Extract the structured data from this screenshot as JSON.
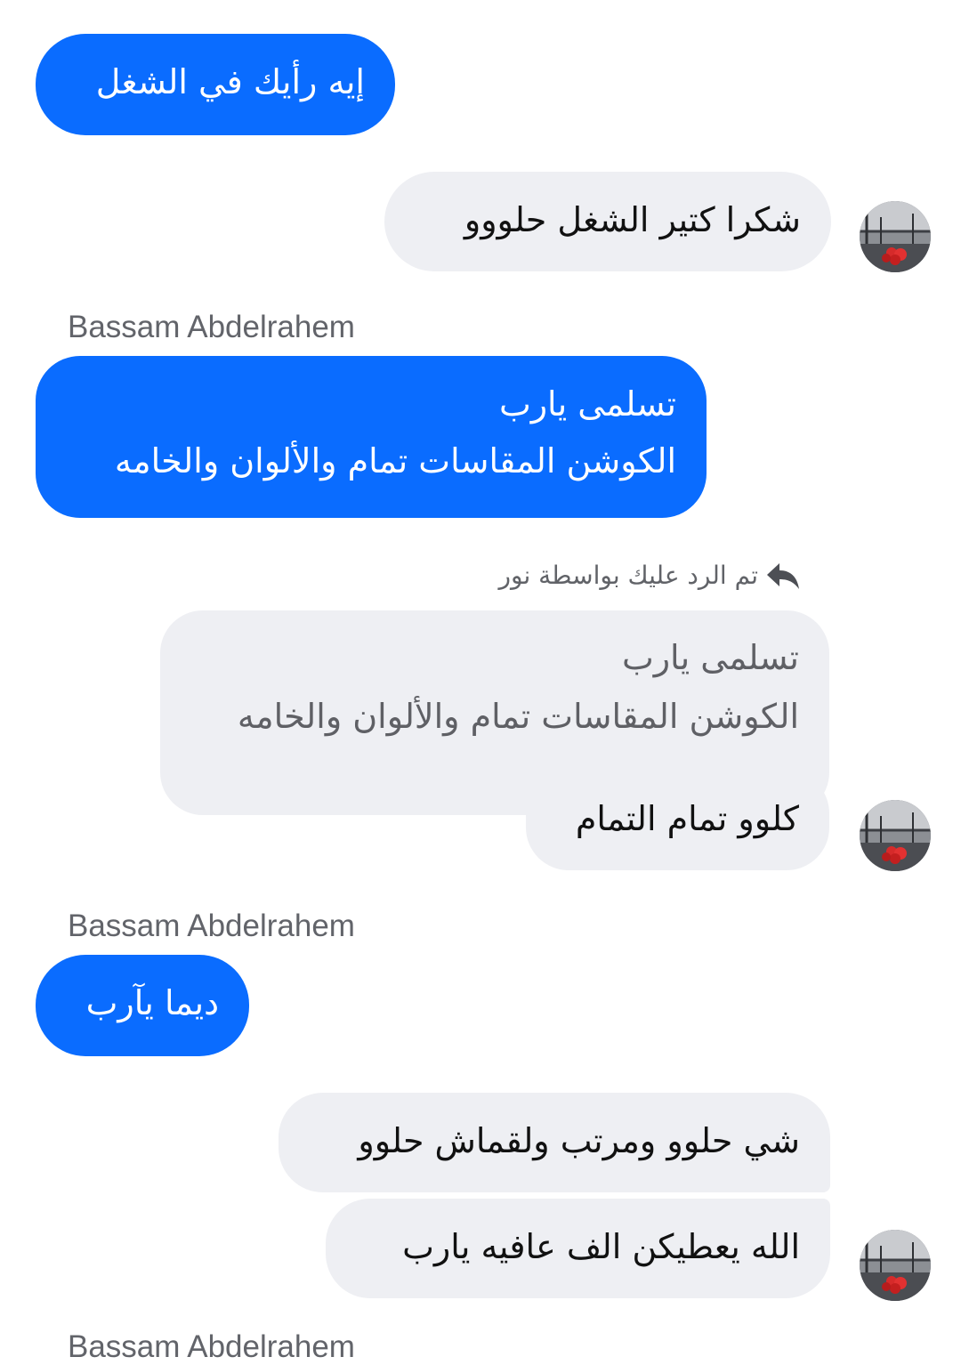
{
  "messages": {
    "m1": {
      "text": "إيه رأيك في الشغل"
    },
    "m2": {
      "text": "شكرا كتير  الشغل حلووو"
    },
    "m3": {
      "sender": "Bassam Abdelrahem",
      "line1": "تسلمى يارب",
      "line2": "الكوشن المقاسات تمام والألوان والخامه"
    },
    "m4": {
      "reply_note": "تم الرد عليك بواسطة نور",
      "quote_line1": "تسلمى يارب",
      "quote_line2": "الكوشن المقاسات تمام والألوان والخامه",
      "text": "كلوو تمام التمام"
    },
    "m5": {
      "sender": "Bassam Abdelrahem",
      "text": "ديما يآرب"
    },
    "m6": {
      "text": "شي حلوو ومرتب ولقماش حلوو"
    },
    "m7": {
      "text": "الله يعطيكن الف عافيه يارب"
    },
    "m8": {
      "sender": "Bassam Abdelrahem"
    }
  },
  "colors": {
    "sent_bubble": "#0a6cff",
    "received_bubble": "#eeeff3",
    "sender_name": "#62646a"
  },
  "icons": {
    "reply": "reply-arrow-icon",
    "avatar": "contact-avatar"
  }
}
